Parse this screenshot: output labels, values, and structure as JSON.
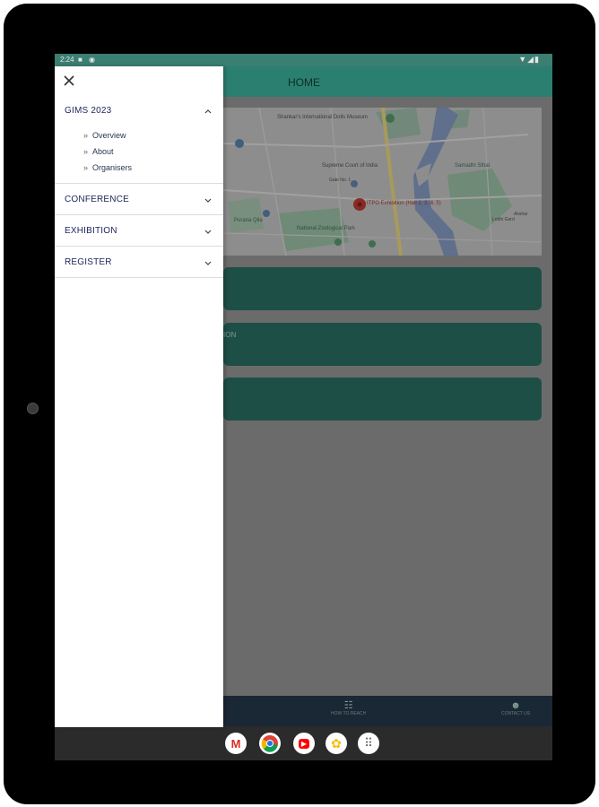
{
  "status_bar": {
    "time": "2:24",
    "left_icons": [
      "lock-icon",
      "alarm-icon"
    ],
    "right_icons": [
      "wifi-icon",
      "signal-icon",
      "battery-icon"
    ]
  },
  "app_bar": {
    "title": "HOME"
  },
  "drawer": {
    "close_icon": "close-icon",
    "sections": [
      {
        "label": "GIMS 2023",
        "expanded": true,
        "items": [
          {
            "label": "Overview"
          },
          {
            "label": "About"
          },
          {
            "label": "Organisers"
          }
        ]
      },
      {
        "label": "CONFERENCE",
        "expanded": false
      },
      {
        "label": "EXHIBITION",
        "expanded": false
      },
      {
        "label": "REGISTER",
        "expanded": false
      }
    ]
  },
  "map": {
    "labels": {
      "museum": "Shankar's International Dolls Museum",
      "itpo": "ITPO Exhibition (Hall 2, 3, 4, 5)",
      "zoo": "National Zoological Park",
      "samadhi": "Samadhi Sthal",
      "supreme": "Supreme Court of India",
      "purana": "Purana Qila",
      "gate": "Gate No. 1",
      "lodhi": "Lodhi Gard",
      "akshar": "Akshar"
    }
  },
  "cards": [
    {
      "label": ""
    },
    {
      "label": "ION"
    },
    {
      "label": ""
    }
  ],
  "bottom_nav": [
    {
      "label": "HOW TO REACH",
      "icon": "route-icon"
    },
    {
      "label": "CONTACT US",
      "icon": "contact-person-icon"
    }
  ],
  "dock": [
    {
      "name": "gmail-icon",
      "glyph": "M",
      "color": "#d93025"
    },
    {
      "name": "chrome-icon",
      "glyph": "",
      "color": "#1a73e8"
    },
    {
      "name": "youtube-icon",
      "glyph": "▶",
      "color": "#ff0000"
    },
    {
      "name": "photos-icon",
      "glyph": "✿",
      "color": "#fbbc04"
    },
    {
      "name": "app-drawer-icon",
      "glyph": "⠿",
      "color": "#5f6368"
    }
  ],
  "colors": {
    "app_bar": "#2a7f70",
    "drawer_text": "#1b2559",
    "scrim_card": "#1d4f47",
    "bottom_nav": "#1a2734"
  }
}
